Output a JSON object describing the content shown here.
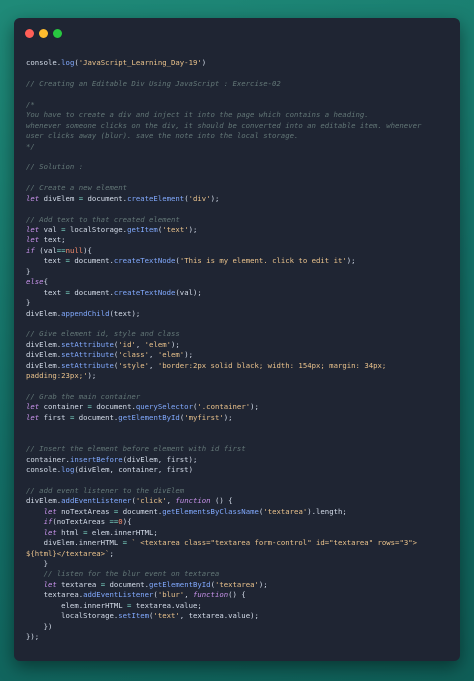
{
  "window": {
    "controls": [
      "close-button",
      "minimize-button",
      "maximize-button"
    ],
    "colors": {
      "close": "#ff5f57",
      "minimize": "#febc2e",
      "maximize": "#28c840",
      "background": "#1f2533"
    }
  },
  "code_lines": [
    [
      [
        "v",
        "console."
      ],
      [
        "f",
        "log"
      ],
      [
        "v",
        "("
      ],
      [
        "s",
        "'JavaScript_Learning_Day-19'"
      ],
      [
        "v",
        ")"
      ]
    ],
    [],
    [
      [
        "c",
        "// Creating an Editable Div Using JavaScript : Exercise-02"
      ]
    ],
    [],
    [
      [
        "c",
        "/*"
      ]
    ],
    [
      [
        "c",
        "You have to create a div and inject it into the page which contains a heading."
      ]
    ],
    [
      [
        "c",
        "whenever someone clicks on the div, it should be converted into an editable item. whenever"
      ]
    ],
    [
      [
        "c",
        "user clicks away (blur). save the note into the local storage."
      ]
    ],
    [
      [
        "c",
        "*/"
      ]
    ],
    [],
    [
      [
        "c",
        "// Solution :"
      ]
    ],
    [],
    [
      [
        "c",
        "// Create a new element"
      ]
    ],
    [
      [
        "k",
        "let"
      ],
      [
        "v",
        " divElem "
      ],
      [
        "p",
        "="
      ],
      [
        "v",
        " document."
      ],
      [
        "f",
        "createElement"
      ],
      [
        "v",
        "("
      ],
      [
        "s",
        "'div'"
      ],
      [
        "v",
        ");"
      ]
    ],
    [],
    [
      [
        "c",
        "// Add text to that created element"
      ]
    ],
    [
      [
        "k",
        "let"
      ],
      [
        "v",
        " val "
      ],
      [
        "p",
        "="
      ],
      [
        "v",
        " localStorage."
      ],
      [
        "f",
        "getItem"
      ],
      [
        "v",
        "("
      ],
      [
        "s",
        "'text'"
      ],
      [
        "v",
        ");"
      ]
    ],
    [
      [
        "k",
        "let"
      ],
      [
        "v",
        " text;"
      ]
    ],
    [
      [
        "k",
        "if"
      ],
      [
        "v",
        " (val"
      ],
      [
        "p",
        "=="
      ],
      [
        "n",
        "null"
      ],
      [
        "v",
        "){"
      ]
    ],
    [
      [
        "v",
        "    text "
      ],
      [
        "p",
        "="
      ],
      [
        "v",
        " document."
      ],
      [
        "f",
        "createTextNode"
      ],
      [
        "v",
        "("
      ],
      [
        "s",
        "'This is my element. click to edit it'"
      ],
      [
        "v",
        ");"
      ]
    ],
    [
      [
        "v",
        "}"
      ]
    ],
    [
      [
        "k",
        "else"
      ],
      [
        "v",
        "{"
      ]
    ],
    [
      [
        "v",
        "    text "
      ],
      [
        "p",
        "="
      ],
      [
        "v",
        " document."
      ],
      [
        "f",
        "createTextNode"
      ],
      [
        "v",
        "(val);"
      ]
    ],
    [
      [
        "v",
        "}"
      ]
    ],
    [
      [
        "v",
        "divElem."
      ],
      [
        "f",
        "appendChild"
      ],
      [
        "v",
        "(text);"
      ]
    ],
    [],
    [
      [
        "c",
        "// Give element id, style and class"
      ]
    ],
    [
      [
        "v",
        "divElem."
      ],
      [
        "f",
        "setAttribute"
      ],
      [
        "v",
        "("
      ],
      [
        "s",
        "'id'"
      ],
      [
        "v",
        ", "
      ],
      [
        "s",
        "'elem'"
      ],
      [
        "v",
        ");"
      ]
    ],
    [
      [
        "v",
        "divElem."
      ],
      [
        "f",
        "setAttribute"
      ],
      [
        "v",
        "("
      ],
      [
        "s",
        "'class'"
      ],
      [
        "v",
        ", "
      ],
      [
        "s",
        "'elem'"
      ],
      [
        "v",
        ");"
      ]
    ],
    [
      [
        "v",
        "divElem."
      ],
      [
        "f",
        "setAttribute"
      ],
      [
        "v",
        "("
      ],
      [
        "s",
        "'style'"
      ],
      [
        "v",
        ", "
      ],
      [
        "s",
        "'border:2px solid black; width: 154px; margin: 34px;"
      ]
    ],
    [
      [
        "s",
        "padding:23px;'"
      ],
      [
        "v",
        ");"
      ]
    ],
    [],
    [
      [
        "c",
        "// Grab the main container"
      ]
    ],
    [
      [
        "k",
        "let"
      ],
      [
        "v",
        " container "
      ],
      [
        "p",
        "="
      ],
      [
        "v",
        " document."
      ],
      [
        "f",
        "querySelector"
      ],
      [
        "v",
        "("
      ],
      [
        "s",
        "'.container'"
      ],
      [
        "v",
        ");"
      ]
    ],
    [
      [
        "k",
        "let"
      ],
      [
        "v",
        " first "
      ],
      [
        "p",
        "="
      ],
      [
        "v",
        " document."
      ],
      [
        "f",
        "getElementById"
      ],
      [
        "v",
        "("
      ],
      [
        "s",
        "'myfirst'"
      ],
      [
        "v",
        ");"
      ]
    ],
    [],
    [],
    [
      [
        "c",
        "// Insert the element before element with id first"
      ]
    ],
    [
      [
        "v",
        "container."
      ],
      [
        "f",
        "insertBefore"
      ],
      [
        "v",
        "(divElem, first);"
      ]
    ],
    [
      [
        "v",
        "console."
      ],
      [
        "f",
        "log"
      ],
      [
        "v",
        "(divElem, container, first)"
      ]
    ],
    [],
    [
      [
        "c",
        "// add event listener to the divElem"
      ]
    ],
    [
      [
        "v",
        "divElem."
      ],
      [
        "f",
        "addEventListener"
      ],
      [
        "v",
        "("
      ],
      [
        "s",
        "'click'"
      ],
      [
        "v",
        ", "
      ],
      [
        "k",
        "function"
      ],
      [
        "v",
        " () {"
      ]
    ],
    [
      [
        "v",
        "    "
      ],
      [
        "k",
        "let"
      ],
      [
        "v",
        " noTextAreas "
      ],
      [
        "p",
        "="
      ],
      [
        "v",
        " document."
      ],
      [
        "f",
        "getElementsByClassName"
      ],
      [
        "v",
        "("
      ],
      [
        "s",
        "'textarea'"
      ],
      [
        "v",
        ").length;"
      ]
    ],
    [
      [
        "v",
        "    "
      ],
      [
        "k",
        "if"
      ],
      [
        "v",
        "(noTextAreas "
      ],
      [
        "p",
        "=="
      ],
      [
        "n",
        "0"
      ],
      [
        "v",
        "){"
      ]
    ],
    [
      [
        "v",
        "    "
      ],
      [
        "k",
        "let"
      ],
      [
        "v",
        " html "
      ],
      [
        "p",
        "="
      ],
      [
        "v",
        " elem.innerHTML;"
      ]
    ],
    [
      [
        "v",
        "    divElem.innerHTML "
      ],
      [
        "p",
        "="
      ],
      [
        "v",
        " "
      ],
      [
        "s",
        "` <textarea class=\"textarea form-control\" id=\"textarea\" rows=\"3\">"
      ]
    ],
    [
      [
        "s",
        "${html}</textarea>`"
      ],
      [
        "v",
        ";"
      ]
    ],
    [
      [
        "v",
        "    }"
      ]
    ],
    [
      [
        "v",
        "    "
      ],
      [
        "c",
        "// listen for the blur event on textarea"
      ]
    ],
    [
      [
        "v",
        "    "
      ],
      [
        "k",
        "let"
      ],
      [
        "v",
        " textarea "
      ],
      [
        "p",
        "="
      ],
      [
        "v",
        " document."
      ],
      [
        "f",
        "getElementById"
      ],
      [
        "v",
        "("
      ],
      [
        "s",
        "'textarea'"
      ],
      [
        "v",
        ");"
      ]
    ],
    [
      [
        "v",
        "    textarea."
      ],
      [
        "f",
        "addEventListener"
      ],
      [
        "v",
        "("
      ],
      [
        "s",
        "'blur'"
      ],
      [
        "v",
        ", "
      ],
      [
        "k",
        "function"
      ],
      [
        "v",
        "() {"
      ]
    ],
    [
      [
        "v",
        "        elem.innerHTML "
      ],
      [
        "p",
        "="
      ],
      [
        "v",
        " textarea.value;"
      ]
    ],
    [
      [
        "v",
        "        localStorage."
      ],
      [
        "f",
        "setItem"
      ],
      [
        "v",
        "("
      ],
      [
        "s",
        "'text'"
      ],
      [
        "v",
        ", textarea.value);"
      ]
    ],
    [
      [
        "v",
        "    })"
      ]
    ],
    [
      [
        "v",
        "});"
      ]
    ]
  ]
}
